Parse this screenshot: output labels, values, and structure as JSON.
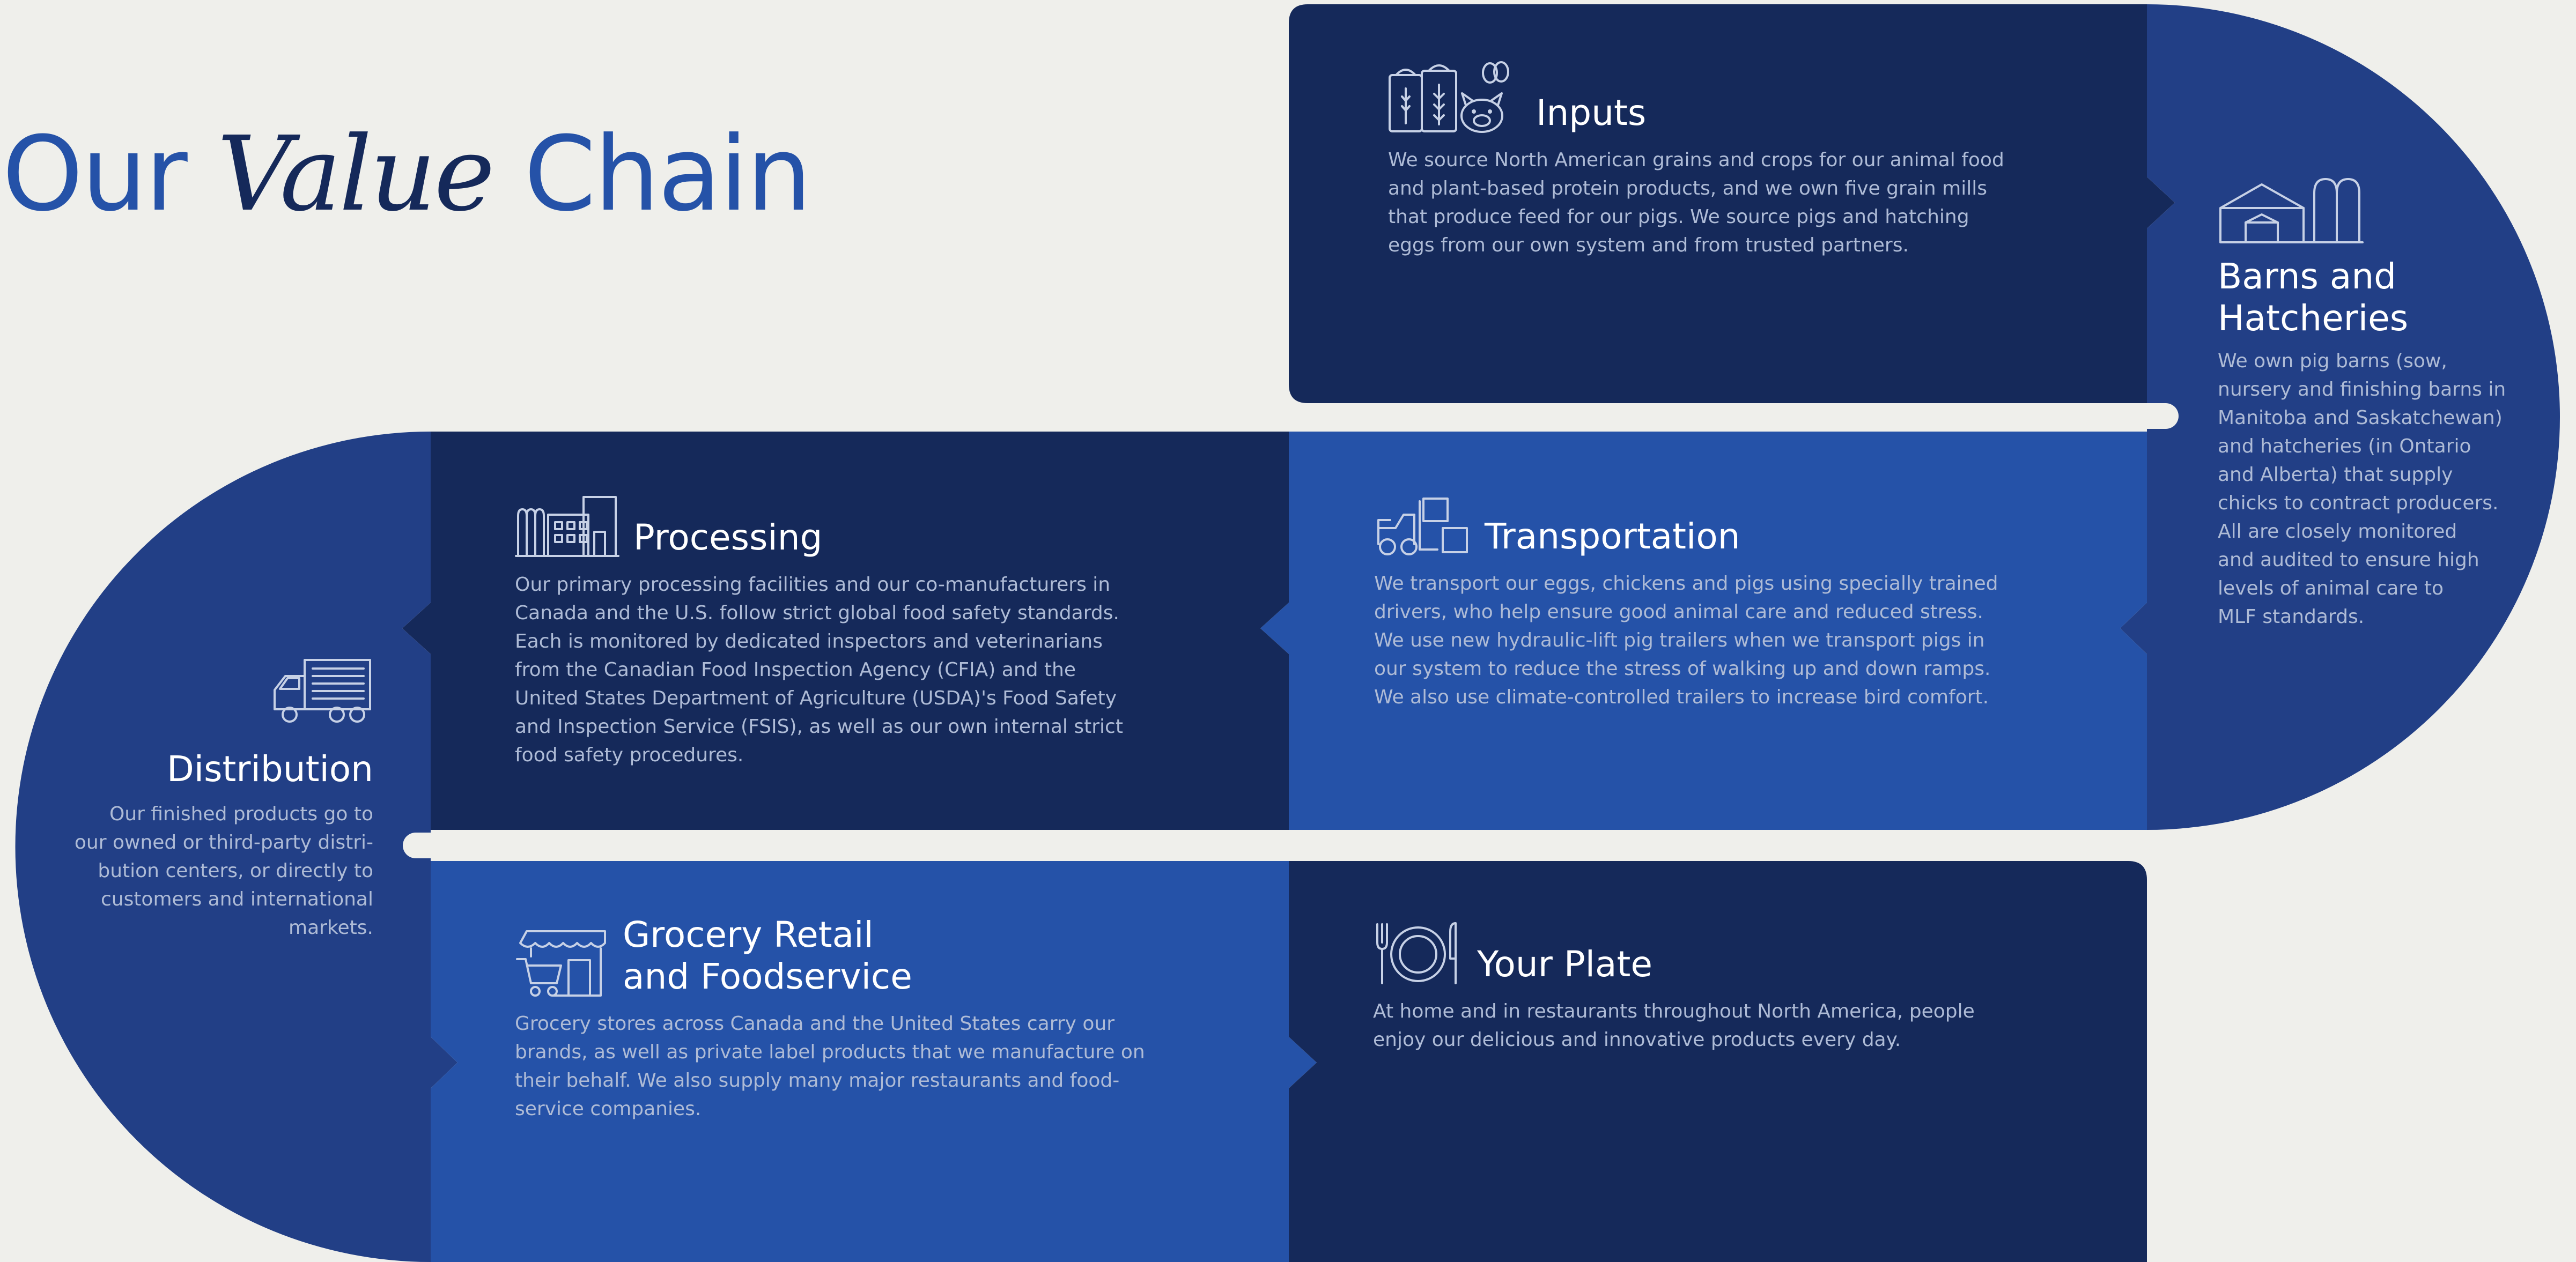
{
  "page_title": {
    "part1": "Our ",
    "part2": "Value",
    "part3": " Chain"
  },
  "colors": {
    "background": "#efefeb",
    "dark_navy": "#15295a",
    "mid_blue": "#223f86",
    "bright_blue": "#2552a8",
    "title_blue": "#2552a8",
    "body_text": "#aebbd6"
  },
  "steps": {
    "inputs": {
      "title": "Inputs",
      "icon": "grain-sacks-pig-egg-icon",
      "body": "We source North American grains and crops for our animal food\nand plant-based protein products, and we own five grain mills\nthat produce feed for our pigs. We source pigs and hatching\neggs from our own system and from trusted partners."
    },
    "barns": {
      "title": "Barns and\nHatcheries",
      "icon": "barn-silo-icon",
      "body": "We own pig barns (sow,\nnursery and finishing barns in\nManitoba and Saskatchewan)\nand hatcheries (in Ontario\nand Alberta) that supply\nchicks to contract producers.\nAll are closely monitored\nand audited to ensure high\nlevels of animal care to\nMLF standards."
    },
    "transportation": {
      "title": "Transportation",
      "icon": "forklift-boxes-icon",
      "body": "We transport our eggs, chickens and pigs using specially trained\ndrivers, who help ensure good animal care and reduced stress.\nWe use new hydraulic-lift pig trailers when we transport pigs in\nour system to reduce the stress of walking up and down ramps.\nWe also use climate-controlled trailers to increase bird comfort."
    },
    "processing": {
      "title": "Processing",
      "icon": "factory-icon",
      "body": "Our primary processing facilities and our co-manufacturers in\nCanada and the U.S. follow strict global food safety standards.\nEach is monitored by dedicated inspectors and veterinarians\nfrom the Canadian Food Inspection Agency (CFIA) and the\nUnited States Department of Agriculture (USDA)'s Food Safety\nand Inspection Service (FSIS), as well as our own internal strict\nfood safety procedures."
    },
    "distribution": {
      "title": "Distribution",
      "icon": "delivery-truck-icon",
      "body": "Our finished products go to\nour owned or third-party distri-\nbution centers, or directly to\ncustomers and international\nmarkets."
    },
    "grocery": {
      "title": "Grocery Retail\nand Foodservice",
      "icon": "storefront-cart-icon",
      "body": "Grocery stores across Canada and the United States carry our\nbrands, as well as private label products that we manufacture on\ntheir behalf. We also supply many major restaurants and food-\nservice companies."
    },
    "plate": {
      "title": "Your Plate",
      "icon": "plate-fork-knife-icon",
      "body": "At home and in restaurants throughout North America, people\nenjoy our delicious and innovative products every day."
    }
  }
}
